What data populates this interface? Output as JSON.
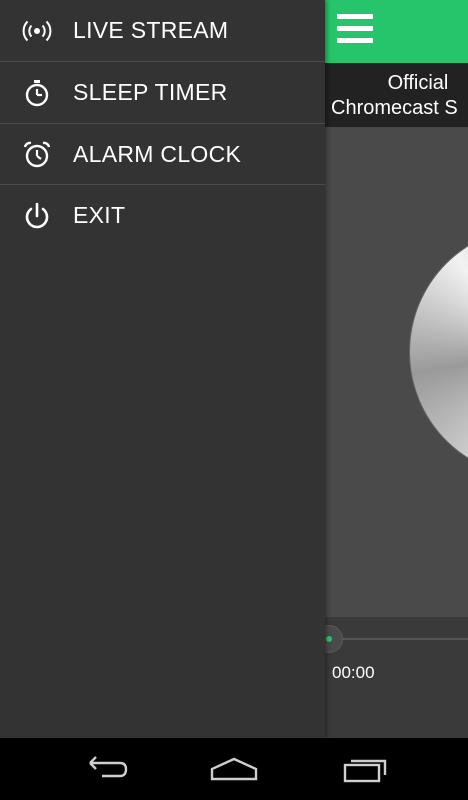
{
  "app": {
    "title_line1": "Official",
    "title_line2": "Chromecast S",
    "accent_color": "#26c56b",
    "player": {
      "current_time": "00:00",
      "progress": 0
    }
  },
  "drawer": {
    "items": [
      {
        "label": "LIVE STREAM",
        "icon": "broadcast-icon"
      },
      {
        "label": "SLEEP TIMER",
        "icon": "stopwatch-icon"
      },
      {
        "label": "ALARM CLOCK",
        "icon": "alarm-clock-icon"
      },
      {
        "label": "EXIT",
        "icon": "power-icon"
      }
    ]
  },
  "navbar": {
    "buttons": [
      {
        "name": "back",
        "icon": "back-arrow-icon"
      },
      {
        "name": "home",
        "icon": "home-icon"
      },
      {
        "name": "recents",
        "icon": "recent-apps-icon"
      }
    ]
  }
}
